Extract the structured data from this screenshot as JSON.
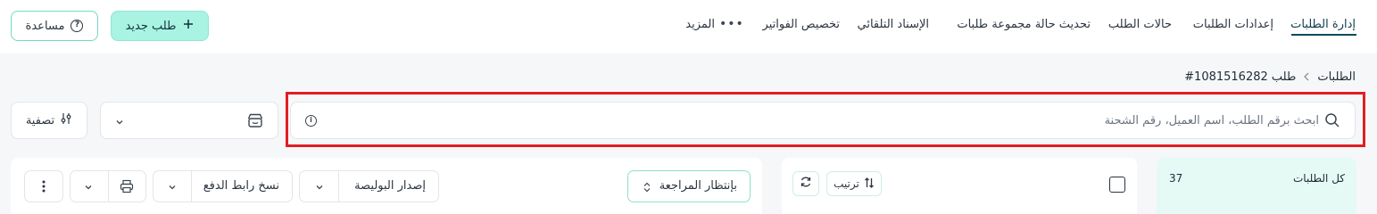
{
  "nav": {
    "items": [
      {
        "label": "إدارة الطلبات",
        "active": true
      },
      {
        "label": "إعدادات الطلبات"
      },
      {
        "label": "حالات الطلب"
      },
      {
        "label": "تحديث حالة مجموعة طلبات"
      },
      {
        "label": "الإسناد التلقائي"
      },
      {
        "label": "تخصيص الفواتير"
      },
      {
        "label": "المزيد"
      }
    ],
    "more_dots": "•••"
  },
  "header": {
    "new_order_label": "طلب جديد",
    "new_order_icon": "plus-icon",
    "help_label": "مساعدة",
    "help_icon": "question-circle-icon",
    "accent_color": "#a9f3e2"
  },
  "breadcrumb": {
    "root": "الطلبات",
    "current": "طلب 1081516282#"
  },
  "search": {
    "placeholder": "ابحث برقم الطلب، اسم العميل، رقم الشحنة",
    "value": "",
    "highlight_color": "#e01e24"
  },
  "filters": {
    "store_icon": "store-icon",
    "filter_label": "تصفية",
    "filter_icon": "sliders-icon"
  },
  "actions": {
    "pending_label": "بإنتظار المراجعة",
    "issue_waybill_label": "إصدار البوليصة",
    "copy_payment_link_label": "نسخ رابط الدفع",
    "print_icon": "printer-icon",
    "more_icon": "kebab-icon"
  },
  "list": {
    "sort_label": "ترتيب",
    "sort_icon": "sort-arrows-icon",
    "refresh_icon": "refresh-icon"
  },
  "sidebar": {
    "all_orders_label": "كل الطلبات",
    "all_orders_count": "37"
  }
}
